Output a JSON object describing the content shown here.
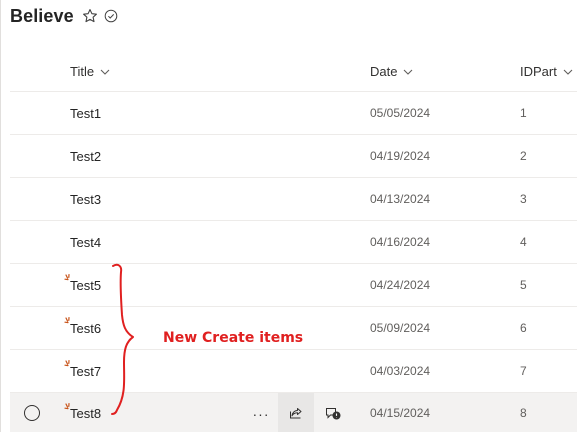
{
  "list": {
    "title": "Believe"
  },
  "icons": {
    "favorite": "star-icon",
    "status": "check-circle-icon",
    "sort": "chevron-down-icon",
    "new_item": "new-item-sparkle-icon",
    "share": "share-icon",
    "comment": "comment-icon",
    "more": "more-icon"
  },
  "columns": {
    "title": "Title",
    "date": "Date",
    "idpart": "IDPart"
  },
  "rows": [
    {
      "title": "Test1",
      "date": "05/05/2024",
      "id": "1",
      "is_new": false
    },
    {
      "title": "Test2",
      "date": "04/19/2024",
      "id": "2",
      "is_new": false
    },
    {
      "title": "Test3",
      "date": "04/13/2024",
      "id": "3",
      "is_new": false
    },
    {
      "title": "Test4",
      "date": "04/16/2024",
      "id": "4",
      "is_new": false
    },
    {
      "title": "Test5",
      "date": "04/24/2024",
      "id": "5",
      "is_new": true
    },
    {
      "title": "Test6",
      "date": "05/09/2024",
      "id": "6",
      "is_new": true
    },
    {
      "title": "Test7",
      "date": "04/03/2024",
      "id": "7",
      "is_new": true
    },
    {
      "title": "Test8",
      "date": "04/15/2024",
      "id": "8",
      "is_new": true
    }
  ],
  "row_actions": {
    "more": "···"
  },
  "annotation": {
    "text": "New Create items",
    "color": "#e02020"
  },
  "colors": {
    "new_icon": "#c8541a",
    "hover_row": "#f3f2f1",
    "divider": "#edebe9"
  }
}
